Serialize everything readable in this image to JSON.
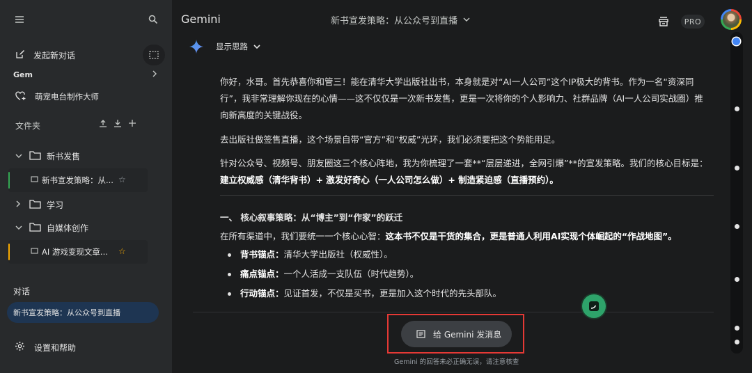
{
  "sidebar": {
    "new_chat": "发起新对话",
    "gem_heading": "Gem",
    "gem_item": "萌宠电台制作大师",
    "files_heading": "文件夹",
    "folders": [
      {
        "label": "新书发售",
        "expanded": true
      },
      {
        "label": "学习",
        "expanded": false
      },
      {
        "label": "自媒体创作",
        "expanded": true
      }
    ],
    "folder_chats": [
      {
        "label": "新书宣发策略：从...",
        "bar_color": "#34a853",
        "starred": false
      },
      {
        "label": "AI 游戏变现文章...",
        "bar_color": "#f9ab00",
        "starred": true
      }
    ],
    "conversations_heading": "对话",
    "active_conversation": "新书宣发策略：从公众号到直播",
    "settings": "设置和帮助"
  },
  "header": {
    "brand": "Gemini",
    "conversation_title": "新书宣发策略：从公众号到直播",
    "pro_badge": "PRO"
  },
  "response": {
    "thinking_toggle": "显示思路",
    "p1": "你好，水哥。首先恭喜你和管三！能在清华大学出版社出书，本身就是对“AI一人公司”这个IP极大的背书。作为一名“资深同行”，我非常理解你现在的心情——这不仅仅是一次新书发售，更是一次将你的个人影响力、社群品牌（AI一人公司实战圈）推向新高度的关键战役。",
    "p2": "去出版社做签售直播，这个场景自带“官方”和“权威”光环，我们必须要把这个势能用足。",
    "p3_text": "针对公众号、视频号、朋友圈这三个核心阵地，我为你梳理了一套**“层层递进，全网引爆”**的宣发策略。我们的核心目标是：",
    "p3_bold": "建立权威感（清华背书）+ 激发好奇心（一人公司怎么做）+ 制造紧迫感（直播预约）。",
    "section_heading": "一、 核心叙事策略：从“博主”到“作家”的跃迁",
    "p4_text": "在所有渠道中，我们要统一一个核心心智：",
    "p4_bold": "这本书不仅是干货的集合，更是普通人利用AI实现个体崛起的“作战地图”。",
    "bullets": [
      {
        "key": "背书锚点：",
        "text": "清华大学出版社（权威性）。"
      },
      {
        "key": "痛点锚点：",
        "text": "一个人活成一支队伍（时代趋势）。"
      },
      {
        "key": "行动锚点：",
        "text": "见证首发，不仅是买书，更是加入这个时代的先头部队。"
      }
    ]
  },
  "composer": {
    "button_label": "给 Gemini 发消息",
    "disclaimer": "Gemini 的回答未必正确无误，请注意核查"
  },
  "scroll_navigator": {
    "markers": 8,
    "active_index": 0
  }
}
